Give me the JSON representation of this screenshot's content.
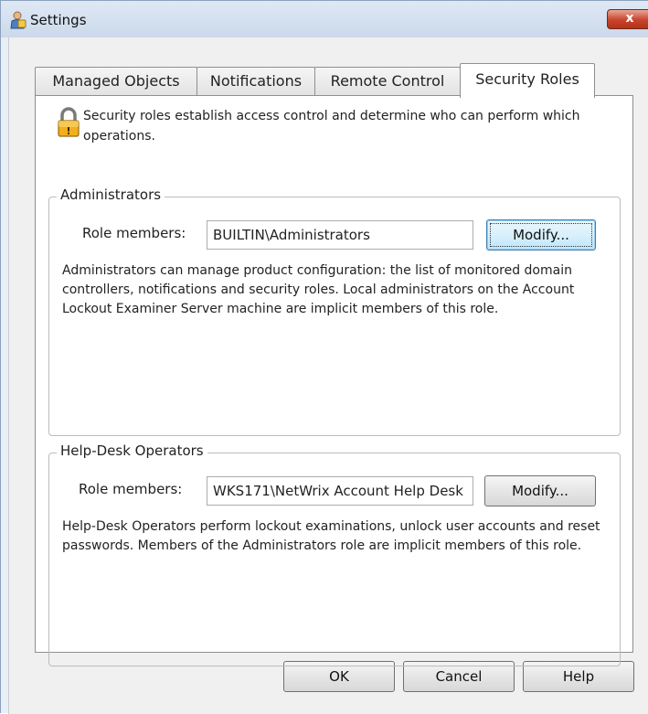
{
  "window": {
    "title": "Settings",
    "close_label": "x"
  },
  "tabs": [
    {
      "label": "Managed Objects",
      "active": false
    },
    {
      "label": "Notifications",
      "active": false
    },
    {
      "label": "Remote Control",
      "active": false
    },
    {
      "label": "Security Roles",
      "active": true
    }
  ],
  "security": {
    "intro": "Security roles establish access control and determine who can perform which operations.",
    "administrators": {
      "legend": "Administrators",
      "role_label": "Role members:",
      "role_value": "BUILTIN\\Administrators",
      "modify_label": "Modify...",
      "description": "Administrators can manage product configuration: the list of monitored domain controllers, notifications and security roles. Local administrators on the Account Lockout Examiner Server machine are implicit members of this role."
    },
    "helpdesk": {
      "legend": "Help-Desk Operators",
      "role_label": "Role members:",
      "role_value": "WKS171\\NetWrix Account Help Desk",
      "modify_label": "Modify...",
      "description": "Help-Desk Operators perform lockout examinations, unlock user accounts and reset passwords. Members of the Administrators role are implicit members of this role."
    }
  },
  "footer": {
    "ok_label": "OK",
    "cancel_label": "Cancel",
    "help_label": "Help"
  }
}
